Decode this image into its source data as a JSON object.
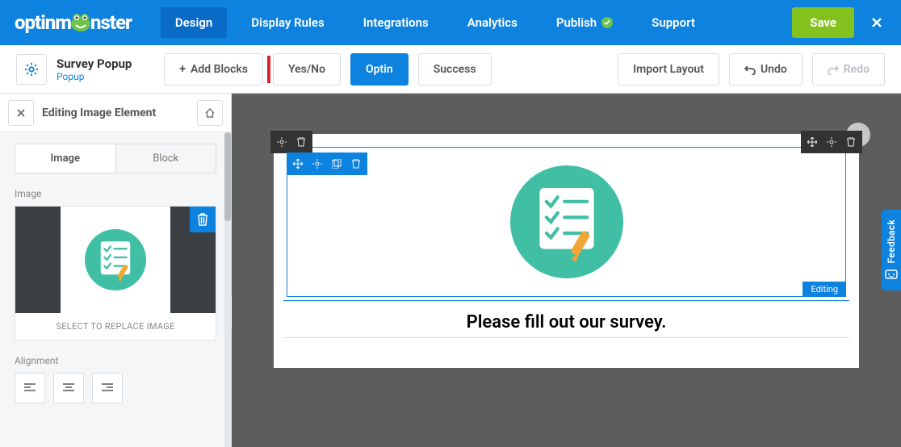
{
  "logo_left": "optinm",
  "logo_right": "nster",
  "nav": {
    "design": "Design",
    "display_rules": "Display Rules",
    "integrations": "Integrations",
    "analytics": "Analytics",
    "publish": "Publish",
    "support": "Support"
  },
  "save": "Save",
  "campaign": {
    "title": "Survey Popup",
    "type": "Popup"
  },
  "toolbar": {
    "add_blocks": "Add Blocks",
    "yes_no": "Yes/No",
    "optin": "Optin",
    "success": "Success",
    "import_layout": "Import Layout",
    "undo": "Undo",
    "redo": "Redo"
  },
  "sidebar": {
    "title": "Editing Image Element",
    "tab_image": "Image",
    "tab_block": "Block",
    "section_image": "Image",
    "select_text": "SELECT TO REPLACE IMAGE",
    "section_alignment": "Alignment"
  },
  "canvas": {
    "caption": "Please fill out our survey.",
    "editing_badge": "Editing"
  },
  "feedback": "Feedback"
}
